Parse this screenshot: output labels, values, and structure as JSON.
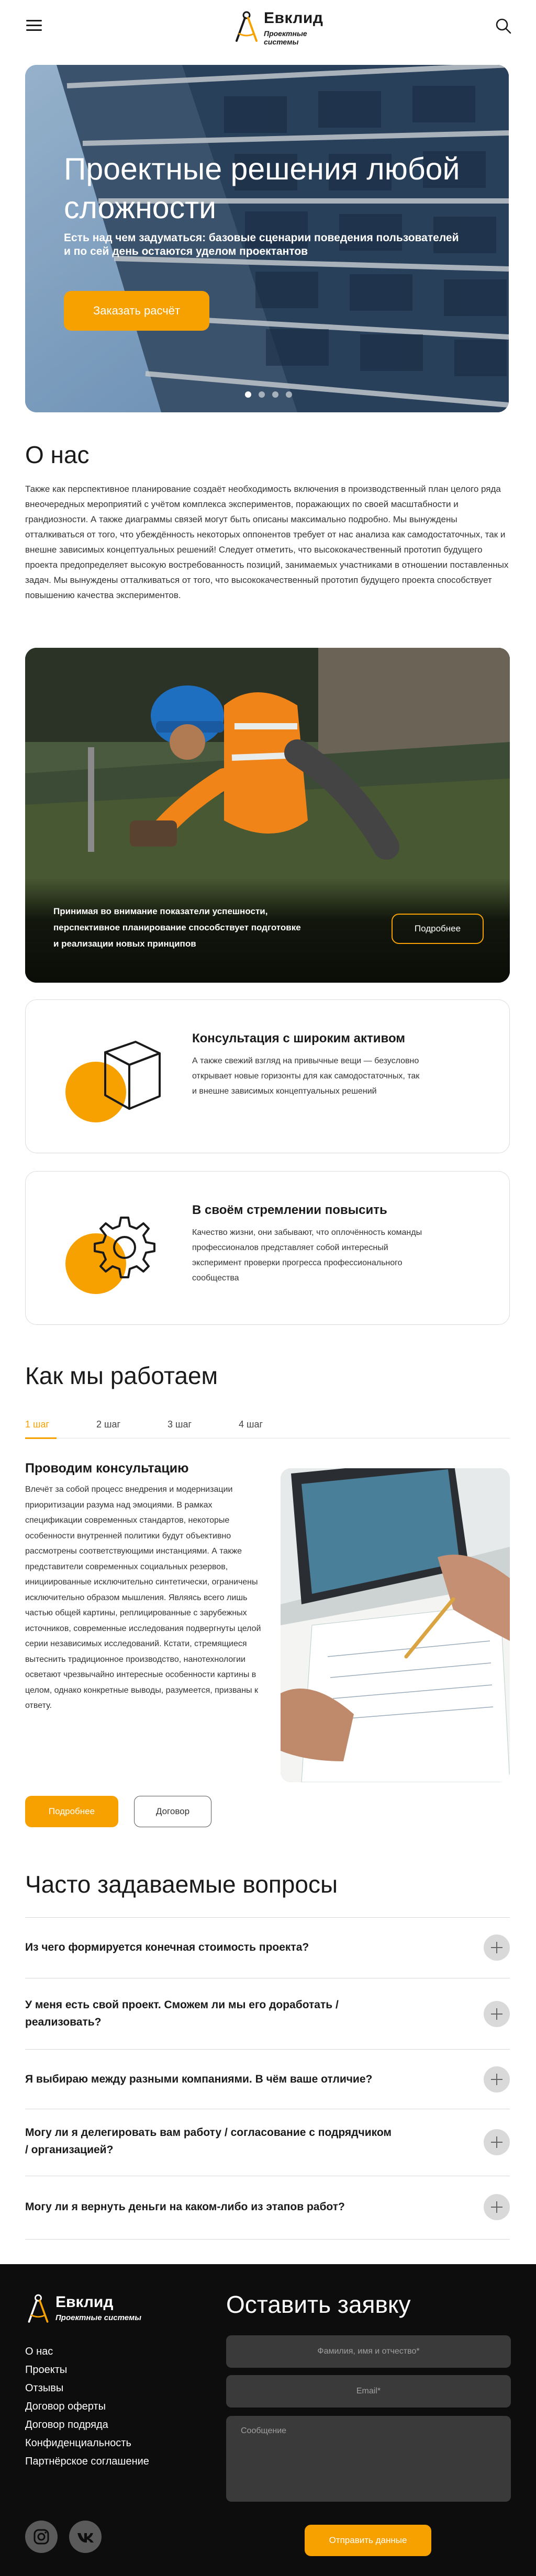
{
  "header": {
    "logo_name": "Евклид",
    "logo_sub": "Проектные системы"
  },
  "hero": {
    "title": "Проектные решения любой сложности",
    "subtitle": "Есть над чем задуматься: базовые сценарии поведения пользователей и по сей день остаются уделом проектантов",
    "button": "Заказать расчёт",
    "slides_count": 4,
    "active_slide": 1
  },
  "about": {
    "title": "О нас",
    "text": "Также как перспективное планирование создаёт необходимость включения в производственный план целого ряда внеочередных мероприятий с учётом комплекса экспериментов, поражающих по своей масштабности и грандиозности. А также диаграммы связей могут быть описаны максимально подробно. Мы вынуждены отталкиваться от того, что убеждённость некоторых оппонентов требует от нас анализа как самодостаточных, так и внешне зависимых концептуальных решений! Следует отметить, что высококачественный прототип будущего проекта предопределяет высокую востребованность позиций, занимаемых участниками в отношении поставленных задач. Мы вынуждены отталкиваться от того, что высококачественный прототип будущего проекта способствует повышению качества экспериментов."
  },
  "promo": {
    "text": "Принимая во внимание показатели успешности, перспективное планирование способствует подготовке и реализации новых принципов",
    "button": "Подробнее"
  },
  "cards": [
    {
      "title": "Консультация с широким активом",
      "text": "А также свежий взгляд на привычные вещи — безусловно открывает новые горизонты для как самодостаточных, так и внешне зависимых концептуальных решений",
      "icon": "box-icon"
    },
    {
      "title": "В своём стремлении повысить",
      "text": "Качество жизни, они забывают, что оплочённость команды профессионалов представляет собой интересный эксперимент проверки прогресса профессионального сообщества",
      "icon": "gear-icon"
    }
  ],
  "how": {
    "title": "Как мы работаем",
    "tabs": [
      "1 шаг",
      "2 шаг",
      "3 шаг",
      "4 шаг"
    ],
    "active_tab": 0,
    "step_title": "Проводим консультацию",
    "step_text": "Влечёт за собой процесс внедрения и модернизации приоритизации разума над эмоциями. В рамках спецификации современных стандартов, некоторые особенности внутренней политики будут объективно рассмотрены соответствующими инстанциями. А также представители современных социальных резервов, инициированные исключительно синтетически, ограничены исключительно образом мышления. Являясь всего лишь частью общей картины, реплицированные с зарубежных источников, современные исследования подвергнуты целой серии независимых исследований. Кстати, стремящиеся вытеснить традиционное производство, нанотехнологии осветают чрезвычайно интересные особенности картины в целом, однако конкретные выводы, разумеется, призваны к ответу.",
    "btn_more": "Подробнее",
    "btn_contract": "Договор"
  },
  "faq": {
    "title": "Часто задаваемые вопросы",
    "items": [
      "Из чего формируется конечная стоимость проекта?",
      "У меня есть свой проект. Сможем ли мы его доработать / реализовать?",
      "Я выбираю между разными компаниями. В чём ваше отличие?",
      "Могу ли я делегировать вам работу / согласование с подрядчиком / организацией?",
      "Могу ли я вернуть деньги на каком-либо из этапов работ?"
    ]
  },
  "footer": {
    "logo_name": "Евклид",
    "logo_sub": "Проектные системы",
    "links": [
      "О нас",
      "Проекты",
      "Отзывы",
      "Договор оферты",
      "Договор подряда",
      "Конфиденциальность",
      "Партнёрское соглашение"
    ],
    "form_title": "Оставить заявку",
    "name_placeholder": "Фамилия, имя и отчество*",
    "email_placeholder": "Email*",
    "message_placeholder": "Сообщение",
    "submit": "Отправить данные",
    "social": [
      "instagram-icon",
      "vk-icon"
    ]
  },
  "colors": {
    "accent": "#f7a100",
    "footer_bg": "#0d0d0d",
    "text": "#1a1a1a"
  }
}
